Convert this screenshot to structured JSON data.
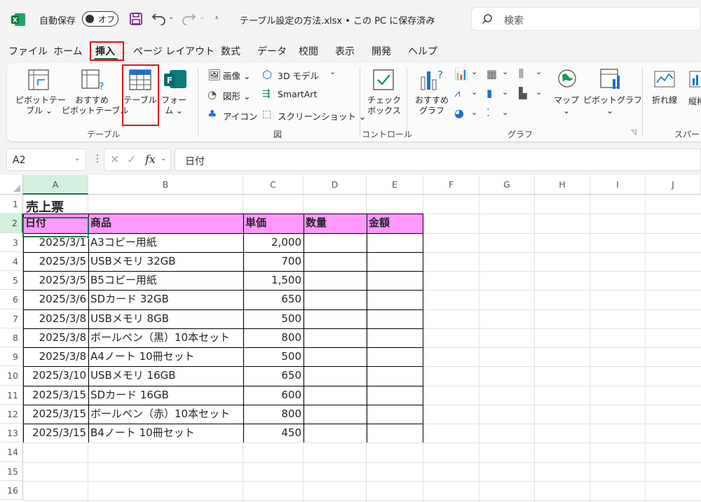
{
  "titlebar": {
    "autosave_label": "自動保存",
    "toggle_state": "オフ",
    "filename": "テーブル設定の方法.xlsx • この PC に保存済み",
    "search_placeholder": "検索"
  },
  "menu": {
    "tabs": [
      "ファイル",
      "ホーム",
      "挿入",
      "ページ レイアウト",
      "数式",
      "データ",
      "校閲",
      "表示",
      "開発",
      "ヘルプ"
    ],
    "active": "挿入"
  },
  "ribbon": {
    "pivot_table": [
      "ピボットテー",
      "ブル ⌄"
    ],
    "recommended_pivot": [
      "おすすめ",
      "ピボットテーブル"
    ],
    "table": "テーブル",
    "form": [
      "フォー",
      "ム ⌄"
    ],
    "group_table": "テーブル",
    "image": "画像 ⌄",
    "shapes": "図形 ⌄",
    "icons": "アイコン",
    "model3d": "3D モデル",
    "smartart": "SmartArt",
    "screenshot": "スクリーンショット ⌄",
    "group_figure": "図",
    "checkbox": [
      "チェック",
      "ボックス"
    ],
    "group_control": "コントロール",
    "recommended_chart": [
      "おすすめ",
      "グラフ"
    ],
    "map": [
      "マップ",
      "⌄"
    ],
    "pivot_chart": [
      "ピボットグラフ",
      "⌄"
    ],
    "group_chart": "グラフ",
    "line": "折れ線",
    "column_partial": "縦棒",
    "group_sparkline_partial": "スパーク"
  },
  "formula_bar": {
    "name_box": "A2",
    "fx": "fx",
    "content": "日付"
  },
  "grid": {
    "columns": [
      "A",
      "B",
      "C",
      "D",
      "E",
      "F",
      "G",
      "H",
      "I",
      "J"
    ],
    "rows": [
      "1",
      "2",
      "3",
      "4",
      "5",
      "6",
      "7",
      "8",
      "9",
      "10",
      "11",
      "12",
      "13",
      "14",
      "15",
      "16"
    ],
    "selected_cell": "A2"
  },
  "sheet": {
    "title": "売上票",
    "headers": [
      "日付",
      "商品",
      "単価",
      "数量",
      "金額"
    ],
    "rows": [
      [
        "2025/3/1",
        "A3コピー用紙",
        "2,000"
      ],
      [
        "2025/3/5",
        "USBメモリ 32GB",
        "700"
      ],
      [
        "2025/3/5",
        "B5コピー用紙",
        "1,500"
      ],
      [
        "2025/3/6",
        "SDカード 32GB",
        "650"
      ],
      [
        "2025/3/8",
        "USBメモリ 8GB",
        "500"
      ],
      [
        "2025/3/8",
        "ボールペン（黒）10本セット",
        "800"
      ],
      [
        "2025/3/8",
        "A4ノート 10冊セット",
        "500"
      ],
      [
        "2025/3/10",
        "USBメモリ 16GB",
        "650"
      ],
      [
        "2025/3/15",
        "SDカード 16GB",
        "600"
      ],
      [
        "2025/3/15",
        "ボールペン（赤）10本セット",
        "800"
      ],
      [
        "2025/3/15",
        "B4ノート 10冊セット",
        "450"
      ]
    ]
  },
  "colors": {
    "excel_green": "#217346",
    "header_fill": "#ff99ff",
    "highlight_red": "#e0121c"
  }
}
